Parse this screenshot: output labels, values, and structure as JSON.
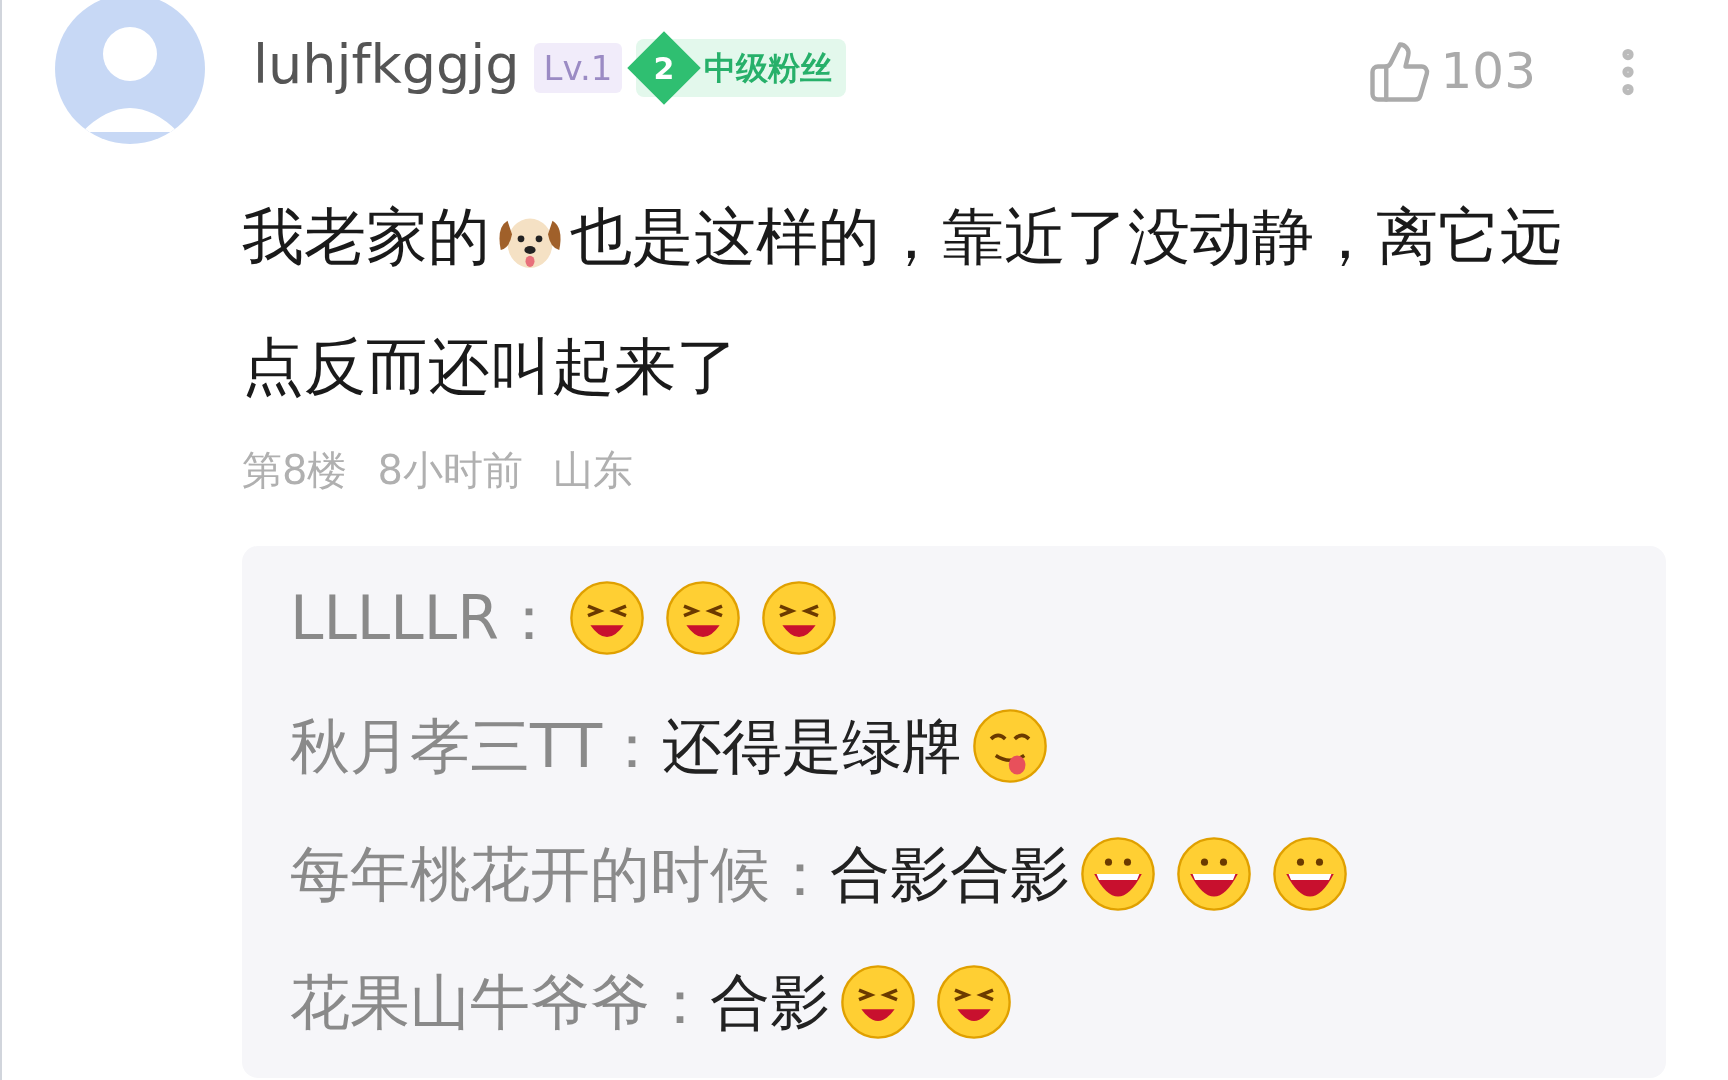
{
  "comment": {
    "username": "luhjfkggjg",
    "level_badge": "Lv.1",
    "fan_badge": {
      "number": "2",
      "label": "中级粉丝"
    },
    "likes": "103",
    "body": [
      {
        "kind": "text",
        "text": "我老家的"
      },
      {
        "kind": "dog"
      },
      {
        "kind": "text",
        "text": "也是这样的，靠近了没动静，离它远点反而还叫起来了"
      }
    ],
    "meta": [
      "第8楼",
      "8小时前",
      "山东"
    ],
    "replies": [
      {
        "author": "LLLLLR：",
        "parts": [
          {
            "kind": "squint"
          },
          {
            "kind": "squint"
          },
          {
            "kind": "squint"
          }
        ]
      },
      {
        "author": "秋月孝三TT：",
        "parts": [
          {
            "kind": "text",
            "text": "还得是绿牌"
          },
          {
            "kind": "tongue"
          }
        ]
      },
      {
        "author": "每年桃花开的时候：",
        "parts": [
          {
            "kind": "text",
            "text": "合影合影"
          },
          {
            "kind": "laugh"
          },
          {
            "kind": "laugh"
          },
          {
            "kind": "laugh"
          }
        ]
      },
      {
        "author": "花果山牛爷爷：",
        "parts": [
          {
            "kind": "text",
            "text": "合影"
          },
          {
            "kind": "squint"
          },
          {
            "kind": "squint"
          }
        ]
      }
    ]
  }
}
